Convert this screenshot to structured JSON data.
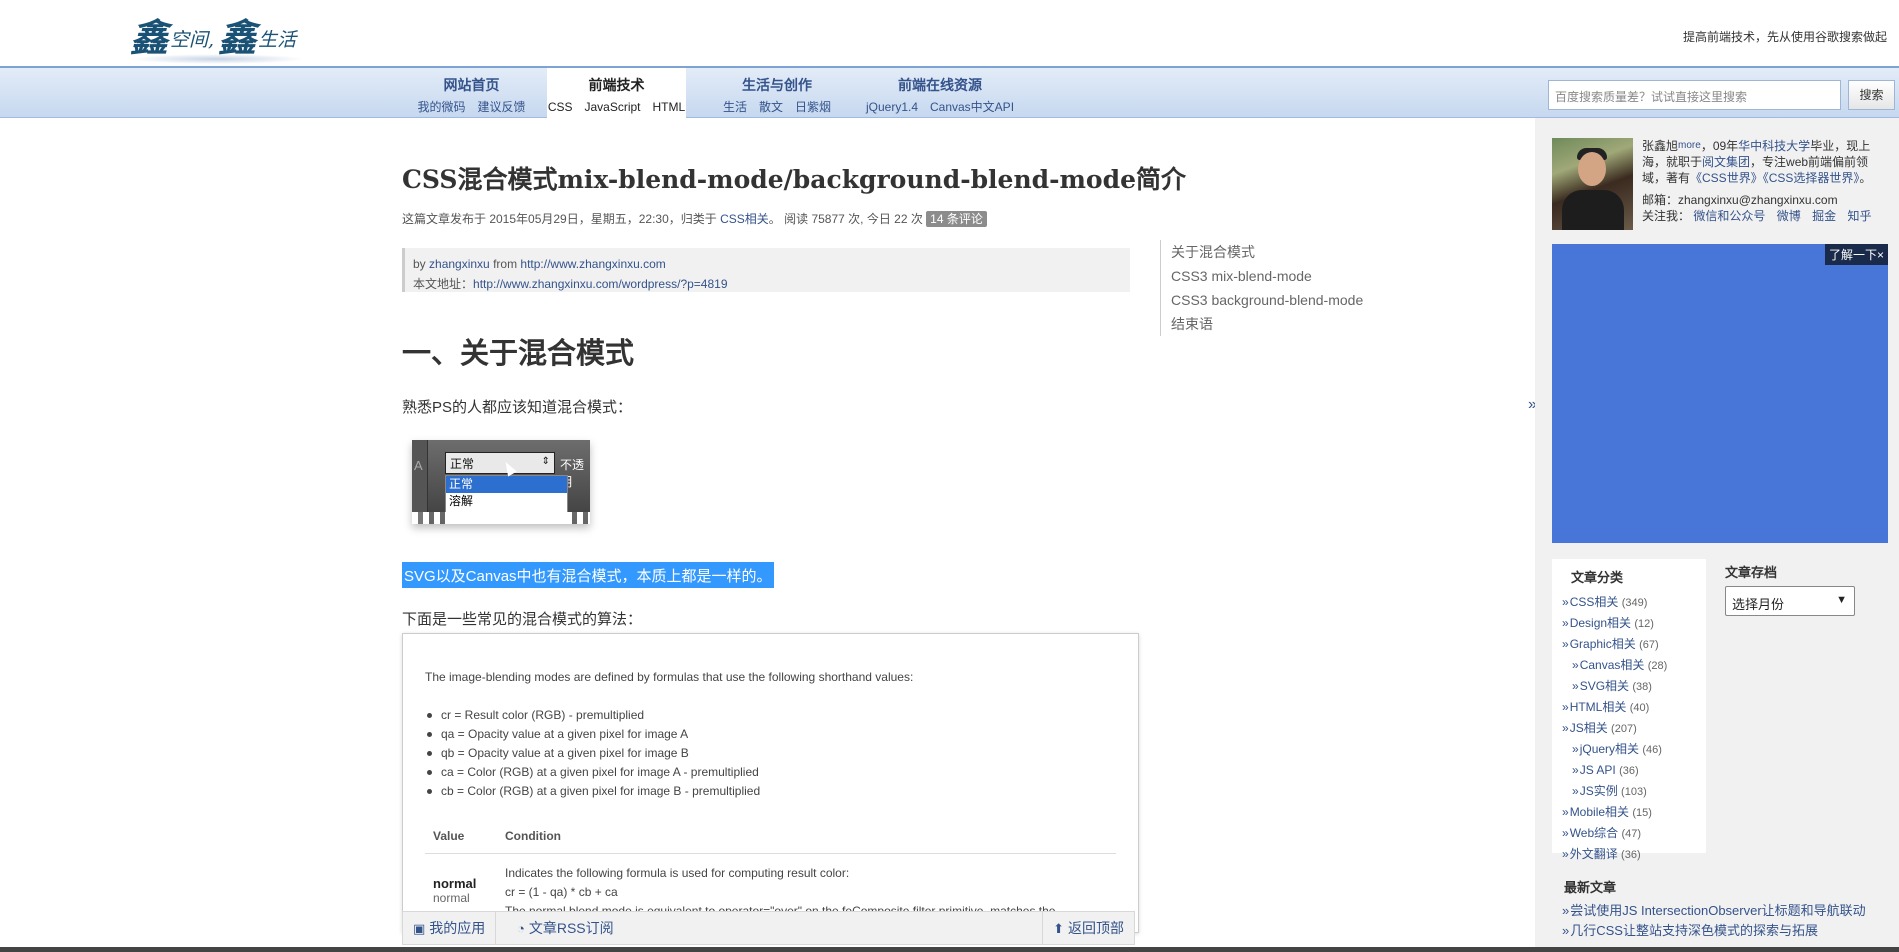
{
  "header": {
    "logo_big_1": "鑫",
    "logo_small_1": "空间,",
    "logo_big_2": "鑫",
    "logo_small_2": "生活",
    "tip": "提高前端技术，先从使用谷歌搜索做起"
  },
  "nav": {
    "items": [
      {
        "title": "网站首页",
        "sub": "我的微码　建议反馈"
      },
      {
        "title": "前端技术",
        "sub": "CSS　JavaScript　HTML"
      },
      {
        "title": "生活与创作",
        "sub": "生活　散文　日紫烟"
      },
      {
        "title": "前端在线资源",
        "sub": "jQuery1.4　Canvas中文API"
      }
    ],
    "search_placeholder": "百度搜索质量差？试试直接这里搜索",
    "search_button": "搜索"
  },
  "article": {
    "title": "CSS混合模式mix-blend-mode/background-blend-mode简介",
    "meta_prefix": "这篇文章发布于 2015年05月29日，星期五，22:30，归类于 ",
    "meta_category": "CSS相关",
    "meta_suffix": "。 阅读 75877 次, 今日 22 次 ",
    "meta_comments": "14 条评论",
    "byline_1_prefix": "by ",
    "byline_author": "zhangxinxu",
    "byline_from": " from ",
    "byline_site": "http://www.zhangxinxu.com",
    "byline_2_prefix": "本文地址：",
    "byline_url": "http://www.zhangxinxu.com/wordpress/?p=4819",
    "h_intro": "一、关于混合模式",
    "p1": "熟悉PS的人都应该知道混合模式：",
    "ps_select": "正常",
    "ps_opacity": "不透明",
    "ps_opt1": "正常",
    "ps_opt2": "溶解",
    "p2": "SVG以及Canvas中也有混合模式，本质上都是一样的。",
    "p3": "下面是一些常见的混合模式的算法："
  },
  "spec": {
    "intro": "The image-blending modes are defined by formulas that use the following shorthand values:",
    "bullets": [
      "cr = Result color (RGB) - premultiplied",
      "qa = Opacity value at a given pixel for image A",
      "qb = Opacity value at a given pixel for image B",
      "ca = Color (RGB) at a given pixel for image A - premultiplied",
      "cb = Color (RGB) at a given pixel for image B - premultiplied"
    ],
    "col_value": "Value",
    "col_condition": "Condition",
    "row_value": "normal",
    "row_value_sub": "normal",
    "row_cond_1": "Indicates the following formula is used for computing result color:",
    "row_cond_2": "cr = (1 - qa) * cb + ca",
    "row_cond_3": "The normal blend mode is equivalent to operator=\"over\" on the feComposite filter primitive, matches the"
  },
  "toc": [
    "关于混合模式",
    "CSS3 mix-blend-mode",
    "CSS3 background-blend-mode",
    "结束语"
  ],
  "sidebar": {
    "toggle": "»",
    "author_name": "张鑫旭",
    "author_more": "more",
    "author_bio_1": "，09年",
    "author_school": "华中科技大学",
    "author_bio_2": "毕业，现上海，就职于",
    "author_company": "阅文集团",
    "author_bio_3": "，专注web前端偏前领域，著有",
    "author_book_1": "《CSS世界》",
    "author_book_2": "《CSS选择器世界》",
    "author_bio_4": "。",
    "email": "邮箱：zhangxinxu@zhangxinxu.com",
    "follow_label": "关注我：",
    "follow_links": [
      "微信和公众号",
      "微博",
      "掘金",
      "知乎"
    ],
    "ad_tag": "了解一下×",
    "categories_title": "文章分类",
    "categories": [
      {
        "name": "CSS相关",
        "count": "(349)",
        "sub": false
      },
      {
        "name": "Design相关",
        "count": "(12)",
        "sub": false
      },
      {
        "name": "Graphic相关",
        "count": "(67)",
        "sub": false
      },
      {
        "name": "Canvas相关",
        "count": "(28)",
        "sub": true
      },
      {
        "name": "SVG相关",
        "count": "(38)",
        "sub": true
      },
      {
        "name": "HTML相关",
        "count": "(40)",
        "sub": false
      },
      {
        "name": "JS相关",
        "count": "(207)",
        "sub": false
      },
      {
        "name": "jQuery相关",
        "count": "(46)",
        "sub": true
      },
      {
        "name": "JS API",
        "count": "(36)",
        "sub": true
      },
      {
        "name": "JS实例",
        "count": "(103)",
        "sub": true
      },
      {
        "name": "Mobile相关",
        "count": "(15)",
        "sub": false
      },
      {
        "name": "Web综合",
        "count": "(47)",
        "sub": false
      },
      {
        "name": "外文翻译",
        "count": "(36)",
        "sub": false
      }
    ],
    "archive_title": "文章存档",
    "archive_select": "选择月份",
    "recent_title": "最新文章",
    "recent": [
      "尝试使用JS IntersectionObserver让标题和导航联动",
      "几行CSS让整站支持深色模式的探索与拓展"
    ]
  },
  "toolbar": {
    "apps": "我的应用",
    "rss": "文章RSS订阅",
    "top": "返回顶部"
  }
}
